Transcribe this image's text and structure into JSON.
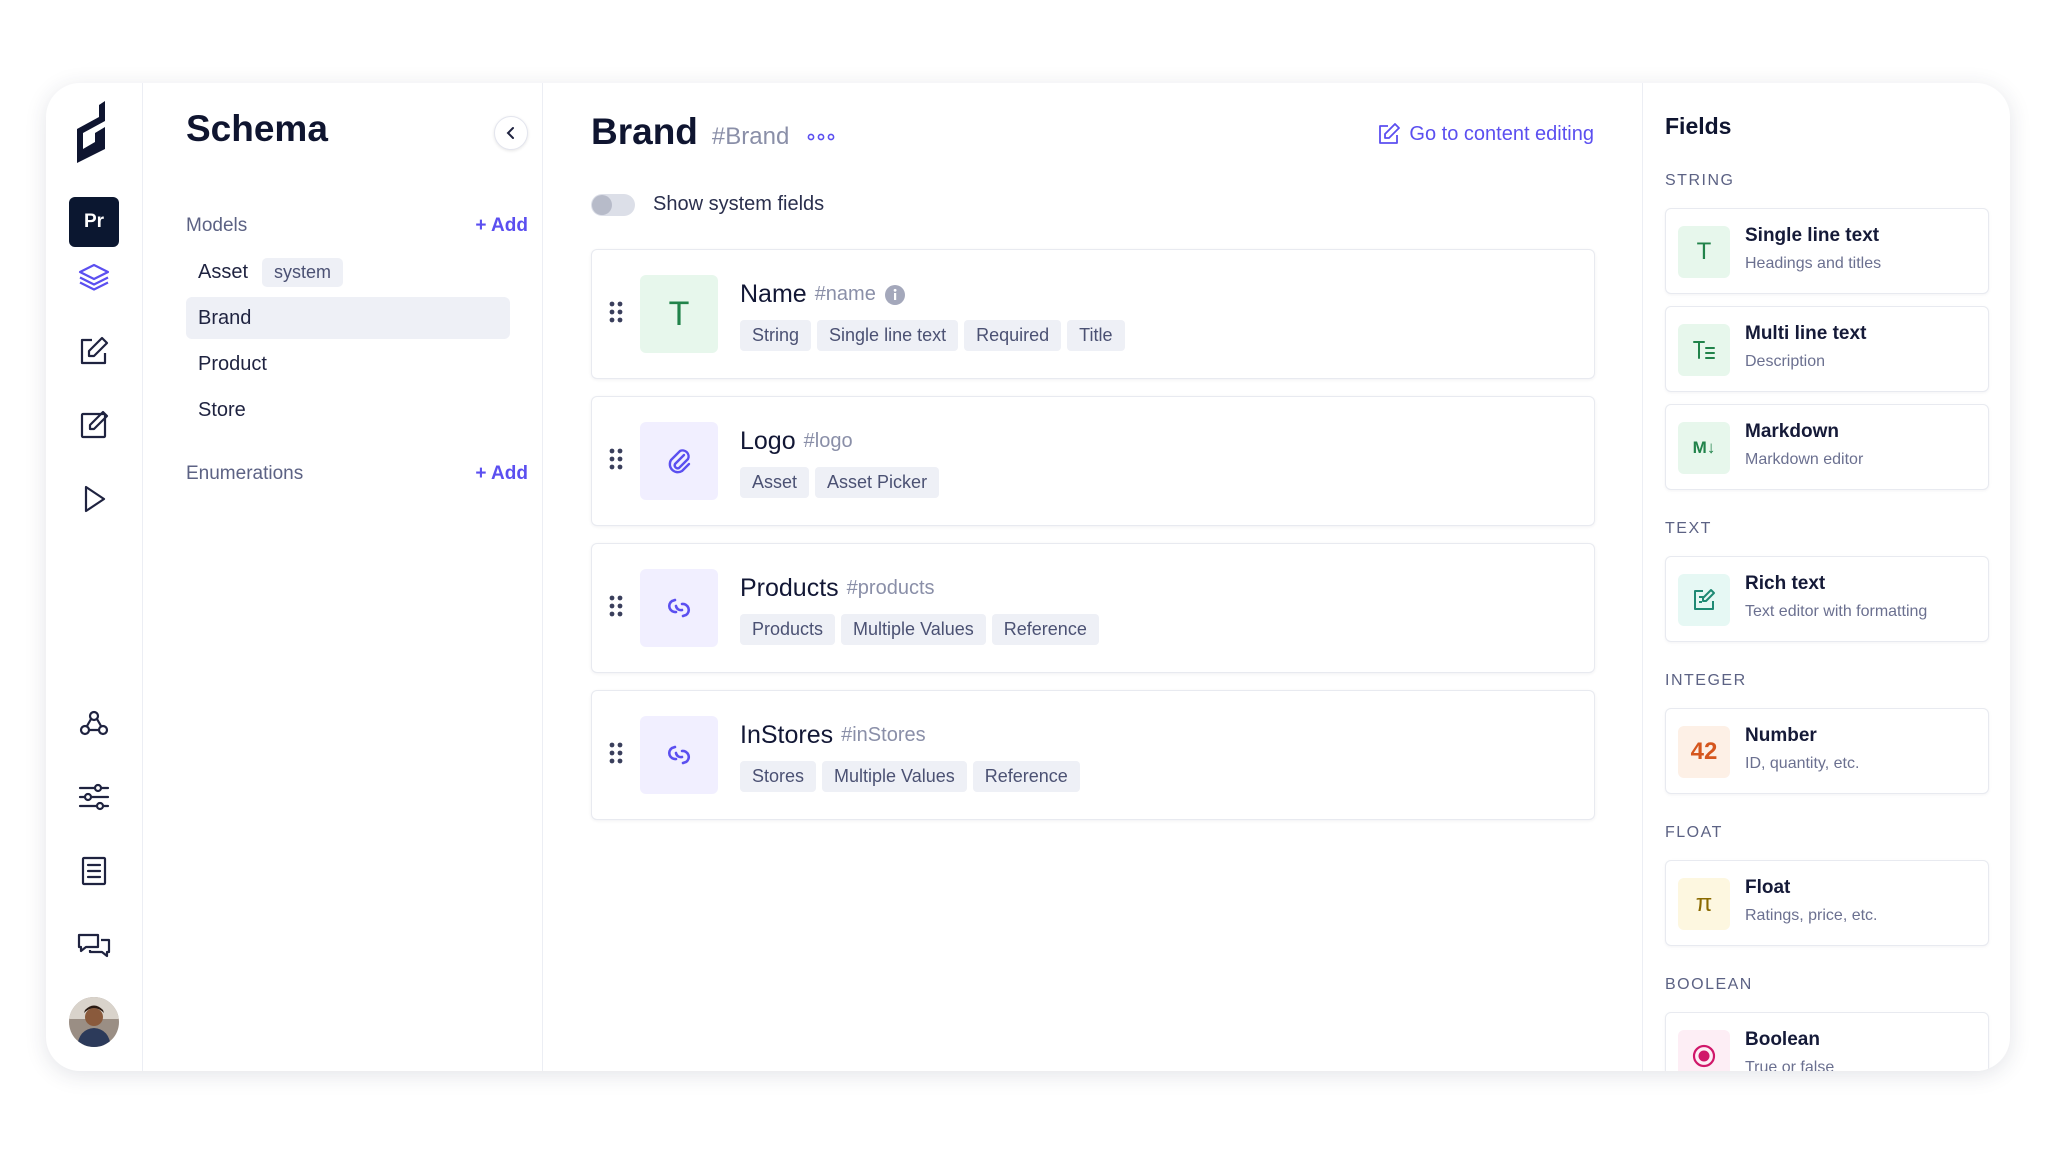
{
  "rail": {
    "project_initials": "Pr",
    "icons": [
      "schema-layers-icon",
      "content-edit-icon",
      "content-edit-alt-icon",
      "playground-icon",
      "webhooks-icon",
      "settings-sliders-icon",
      "docs-icon",
      "chat-icon"
    ],
    "accent": "#5b4ff0"
  },
  "sidebar": {
    "title": "Schema",
    "models_label": "Models",
    "add_label": "+ Add",
    "models": [
      {
        "name": "Asset",
        "badge": "system"
      },
      {
        "name": "Brand"
      },
      {
        "name": "Product"
      },
      {
        "name": "Store"
      }
    ],
    "enumerations_label": "Enumerations"
  },
  "main": {
    "title": "Brand",
    "api_id": "#Brand",
    "goto_label": "Go to content editing",
    "toggle_label": "Show system fields",
    "fields": [
      {
        "name": "Name",
        "api_id": "#name",
        "icon": "text-t-icon",
        "tags": [
          "String",
          "Single line text",
          "Required",
          "Title"
        ]
      },
      {
        "name": "Logo",
        "api_id": "#logo",
        "icon": "paperclip-icon",
        "tags": [
          "Asset",
          "Asset Picker"
        ]
      },
      {
        "name": "Products",
        "api_id": "#products",
        "icon": "link-icon",
        "tags": [
          "Products",
          "Multiple Values",
          "Reference"
        ]
      },
      {
        "name": "InStores",
        "api_id": "#inStores",
        "icon": "link-icon",
        "tags": [
          "Stores",
          "Multiple Values",
          "Reference"
        ]
      }
    ]
  },
  "fields_panel": {
    "title": "Fields",
    "categories": {
      "string": "STRING",
      "text": "TEXT",
      "integer": "INTEGER",
      "float": "FLOAT",
      "boolean": "BOOLEAN"
    },
    "items": [
      {
        "glyph": "T",
        "name": "Single line text",
        "desc": "Headings and titles"
      },
      {
        "glyph": "",
        "name": "Multi line text",
        "desc": "Description"
      },
      {
        "glyph": "M↓",
        "name": "Markdown",
        "desc": "Markdown editor"
      },
      {
        "glyph": "",
        "name": "Rich text",
        "desc": "Text editor with formatting"
      },
      {
        "glyph": "42",
        "name": "Number",
        "desc": "ID, quantity, etc."
      },
      {
        "glyph": "π",
        "name": "Float",
        "desc": "Ratings, price, etc."
      },
      {
        "glyph": "",
        "name": "Boolean",
        "desc": "True or false"
      }
    ]
  }
}
